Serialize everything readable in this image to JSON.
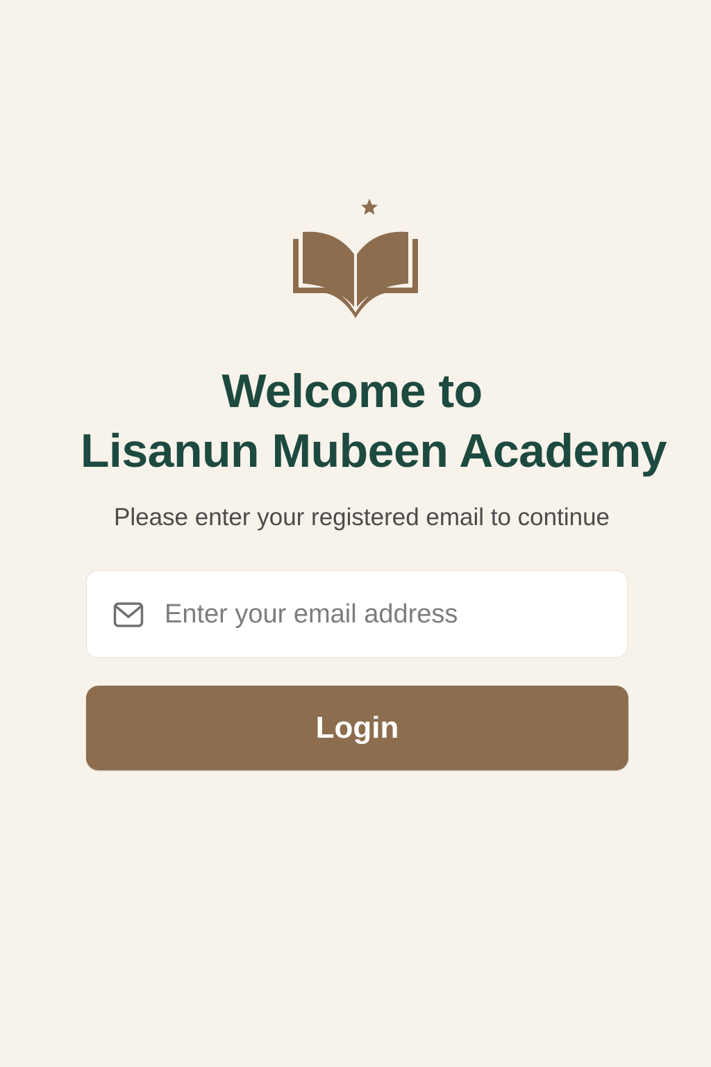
{
  "colors": {
    "background": "#f8f3ea",
    "brand_brown": "#8c6d4e",
    "title_green": "#1d4a40",
    "subtitle_gray": "#4b4b4b",
    "input_background": "#ffffff",
    "placeholder_gray": "#7d7d7d"
  },
  "logo": {
    "icon": "open-book-crescent-star-icon"
  },
  "header": {
    "title_line1": "Welcome to",
    "title_line2": "Lisanun Mubeen Academy",
    "subtitle": "Please enter your registered email to continue"
  },
  "form": {
    "email": {
      "icon": "mail-icon",
      "placeholder": "Enter your email address",
      "value": ""
    },
    "login_label": "Login"
  }
}
